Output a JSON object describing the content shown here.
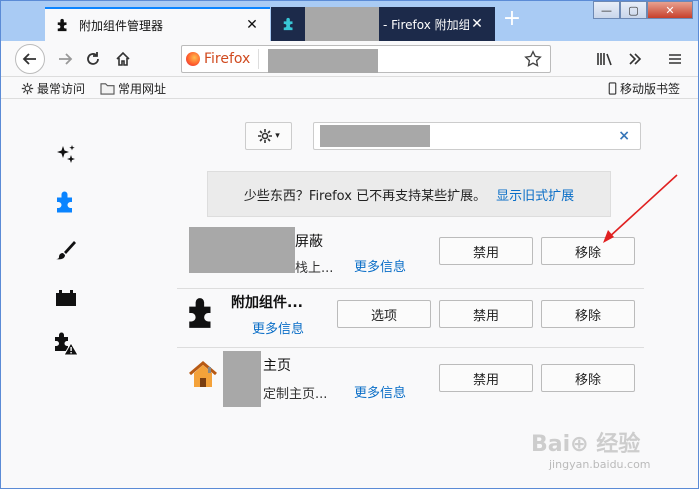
{
  "window": {
    "tabs": [
      {
        "title": "附加组件管理器",
        "active": true
      },
      {
        "title": "- Firefox 附加组",
        "active": false
      }
    ],
    "new_tab": "+",
    "controls": {
      "minimize": "—",
      "maximize": "▢",
      "close": "✕"
    }
  },
  "navbar": {
    "identity_label": "Firefox",
    "icons": [
      "back-icon",
      "forward-icon",
      "reload-icon",
      "home-icon",
      "bookmark-star-icon",
      "library-icon",
      "overflow-icon",
      "menu-icon"
    ]
  },
  "bookmarks": {
    "items": [
      {
        "label": "最常访问",
        "icon": "gear-icon"
      },
      {
        "label": "常用网址",
        "icon": "folder-icon"
      }
    ],
    "mobile": "移动版书签"
  },
  "categories": [
    "discover-icon",
    "extensions-icon",
    "themes-icon",
    "plugins-icon",
    "legacy-icon"
  ],
  "toolbar": {
    "search_clear": "×"
  },
  "notice": {
    "text": "少些东西？Firefox 已不再支持某些扩展。",
    "link": "显示旧式扩展"
  },
  "addons": [
    {
      "name_visible": "屏蔽",
      "desc_visible": "栈上...",
      "more": "更多信息",
      "disable": "禁用",
      "remove": "移除"
    },
    {
      "name_visible": "附加组件...",
      "more": "更多信息",
      "options": "选项",
      "disable": "禁用",
      "remove": "移除"
    },
    {
      "name_visible": "主页",
      "desc_visible": "定制主页...",
      "more": "更多信息",
      "disable": "禁用",
      "remove": "移除"
    }
  ],
  "watermark": {
    "main": "Bai⊕ 经验",
    "sub": "jingyan.baidu.com"
  },
  "colors": {
    "accent": "#0a84ff",
    "link": "#0a6ec7",
    "annotation_arrow": "#e02020"
  }
}
